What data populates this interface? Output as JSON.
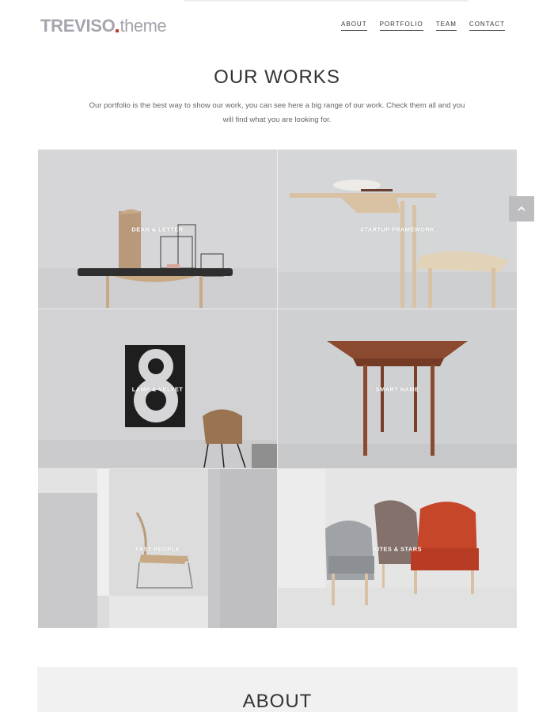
{
  "brand": {
    "logo_main": "TREVISO",
    "logo_sub": "theme"
  },
  "nav": {
    "items": [
      "ABOUT",
      "PORTFOLIO",
      "TEAM",
      "CONTACT"
    ]
  },
  "works": {
    "title": "OUR WORKS",
    "intro": "Our portfolio is the best way to show our work, you can see here a big range of our work. Check them all and you will find what you are looking for.",
    "items": [
      {
        "label": "DEAN & LETTER"
      },
      {
        "label": "STARTUP FRAMEWORK"
      },
      {
        "label": "LAMP & VELVET"
      },
      {
        "label": "SMART NAME"
      },
      {
        "label": "FAST PEOPLE"
      },
      {
        "label": "KITES & STARS"
      }
    ]
  },
  "scroll_top": {
    "icon": "chevron-up-icon"
  },
  "about": {
    "title": "ABOUT"
  },
  "colors": {
    "accent": "#c0392b",
    "logo": "#a6a4ad",
    "tile_bg": "#d4d4d6"
  }
}
